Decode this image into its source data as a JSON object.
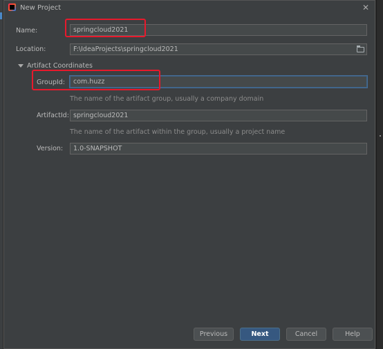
{
  "window": {
    "title": "New Project"
  },
  "form": {
    "name": {
      "label": "Name:",
      "value": "springcloud2021"
    },
    "location": {
      "label": "Location:",
      "value": "F:\\IdeaProjects\\springcloud2021"
    },
    "artifact_section": "Artifact Coordinates",
    "group_id": {
      "label": "GroupId:",
      "value": "com.huzz",
      "hint": "The name of the artifact group, usually a company domain"
    },
    "artifact_id": {
      "label": "ArtifactId:",
      "value": "springcloud2021",
      "hint": "The name of the artifact within the group, usually a project name"
    },
    "version": {
      "label": "Version:",
      "value": "1.0-SNAPSHOT"
    }
  },
  "buttons": {
    "previous": "Previous",
    "next": "Next",
    "cancel": "Cancel",
    "help": "Help"
  },
  "colors": {
    "background": "#3c3f41",
    "field": "#45494a",
    "primary_button": "#365880",
    "highlight": "#e8192c"
  }
}
